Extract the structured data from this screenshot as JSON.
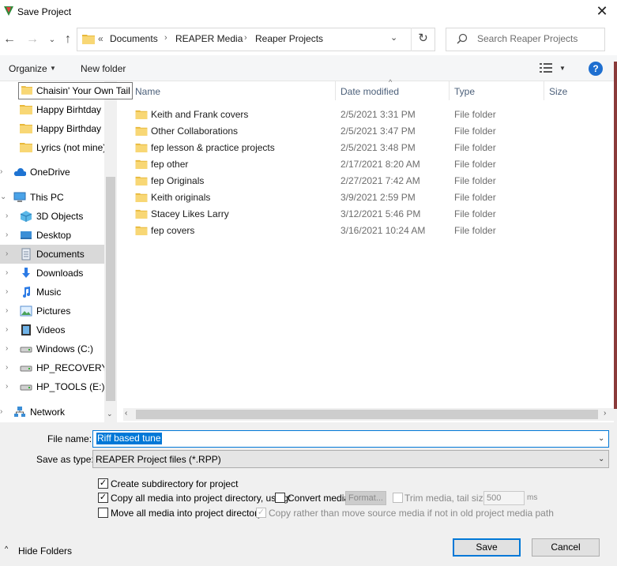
{
  "window": {
    "title": "Save Project",
    "close_glyph": "✕"
  },
  "nav": {
    "back_glyph": "←",
    "forward_glyph": "→",
    "recent_glyph": "⌄",
    "up_glyph": "↑",
    "breadcrumb_prefix": "«",
    "breadcrumb": [
      "Documents",
      "REAPER Media",
      "Reaper Projects"
    ],
    "breadcrumb_sep": "›",
    "dropdown_glyph": "⌄",
    "refresh_glyph": "↻",
    "search_placeholder": "Search Reaper Projects"
  },
  "toolbar": {
    "organize_label": "Organize",
    "caret": "▼",
    "new_folder_label": "New folder",
    "help_label": "?"
  },
  "tooltip": {
    "text": "Chaisin' Your Own Tail"
  },
  "sidebar": {
    "items": [
      {
        "label": "Happy Birhtday",
        "icon": "folder-icon",
        "indent": 1
      },
      {
        "label": "Happy Birthday",
        "icon": "folder-icon",
        "indent": 1
      },
      {
        "label": "Lyrics (not mine)",
        "icon": "folder-icon",
        "indent": 1
      },
      {
        "label": "OneDrive",
        "icon": "onedrive-icon",
        "indent": 0,
        "chevron": "›"
      },
      {
        "label": "This PC",
        "icon": "pc-icon",
        "indent": 0,
        "chevron": "⌄"
      },
      {
        "label": "3D Objects",
        "icon": "3d-objects-icon",
        "indent": 1,
        "chevron": "›"
      },
      {
        "label": "Desktop",
        "icon": "desktop-icon",
        "indent": 1,
        "chevron": "›"
      },
      {
        "label": "Documents",
        "icon": "documents-icon",
        "indent": 1,
        "chevron": "›",
        "selected": true
      },
      {
        "label": "Downloads",
        "icon": "downloads-icon",
        "indent": 1,
        "chevron": "›"
      },
      {
        "label": "Music",
        "icon": "music-icon",
        "indent": 1,
        "chevron": "›"
      },
      {
        "label": "Pictures",
        "icon": "pictures-icon",
        "indent": 1,
        "chevron": "›"
      },
      {
        "label": "Videos",
        "icon": "videos-icon",
        "indent": 1,
        "chevron": "›"
      },
      {
        "label": "Windows (C:)",
        "icon": "drive-icon",
        "indent": 1,
        "chevron": "›"
      },
      {
        "label": "HP_RECOVERY (",
        "icon": "drive-icon",
        "indent": 1,
        "chevron": "›"
      },
      {
        "label": "HP_TOOLS (E:)",
        "icon": "drive-icon",
        "indent": 1,
        "chevron": "›"
      },
      {
        "label": "Network",
        "icon": "network-icon",
        "indent": 0,
        "chevron": "›"
      }
    ],
    "scroll_down_glyph": "⌄"
  },
  "filelist": {
    "columns": [
      "Name",
      "Date modified",
      "Type",
      "Size"
    ],
    "sort_glyph": "^",
    "rows": [
      {
        "name": "Keith and Frank covers",
        "date": "2/5/2021 3:31 PM",
        "type": "File folder"
      },
      {
        "name": "Other Collaborations",
        "date": "2/5/2021 3:47 PM",
        "type": "File folder"
      },
      {
        "name": "fep lesson & practice projects",
        "date": "2/5/2021 3:48 PM",
        "type": "File folder"
      },
      {
        "name": "fep other",
        "date": "2/17/2021 8:20 AM",
        "type": "File folder"
      },
      {
        "name": "fep Originals",
        "date": "2/27/2021 7:42 AM",
        "type": "File folder"
      },
      {
        "name": "Keith originals",
        "date": "3/9/2021 2:59 PM",
        "type": "File folder"
      },
      {
        "name": "Stacey Likes Larry",
        "date": "3/12/2021 5:46 PM",
        "type": "File folder"
      },
      {
        "name": "fep covers",
        "date": "3/16/2021 10:24 AM",
        "type": "File folder"
      }
    ],
    "scroll_left_glyph": "‹",
    "scroll_right_glyph": "›"
  },
  "form": {
    "file_name_label": "File name:",
    "file_name_value": "Riff based tune",
    "save_type_label": "Save as type:",
    "save_type_value": "REAPER Project files (*.RPP)",
    "dropdown_glyph": "⌄"
  },
  "options": {
    "check_glyph": "✓",
    "create_subdir": "Create subdirectory for project",
    "copy_media": "Copy all media into project directory, using:",
    "convert_media": "Convert media",
    "format_btn": "Format...",
    "trim_media": "Trim media, tail size:",
    "tail_value": "500",
    "ms": "ms",
    "move_media": "Move all media into project directory",
    "copy_rather": "Copy rather than move source media if not in old project media path"
  },
  "footer": {
    "hide_folders": "Hide Folders",
    "hide_caret": "^",
    "save": "Save",
    "cancel": "Cancel"
  },
  "colors": {
    "accent": "#0078d7",
    "folder": "#f8d775",
    "folder_dark": "#e8b83a",
    "help": "#1e6fd0"
  }
}
